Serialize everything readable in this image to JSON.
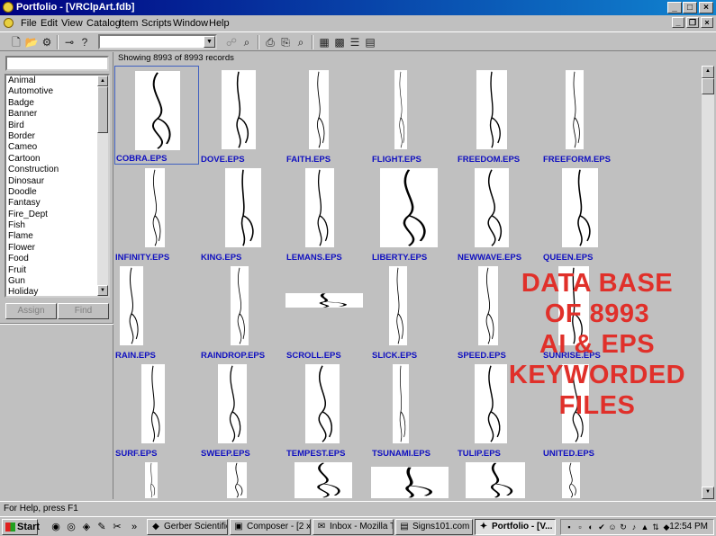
{
  "window": {
    "title": "Portfolio - [VRClpArt.fdb]",
    "minimize": "_",
    "maximize": "□",
    "close": "×"
  },
  "menu": [
    "File",
    "Edit",
    "View",
    "Catalog",
    "Item",
    "Scripts",
    "Window",
    "Help"
  ],
  "toolbar": {
    "search_combo_value": ""
  },
  "left_pane": {
    "search_value": "",
    "keywords": [
      "Animal",
      "Automotive",
      "Badge",
      "Banner",
      "Bird",
      "Border",
      "Cameo",
      "Cartoon",
      "Construction",
      "Dinosaur",
      "Doodle",
      "Fantasy",
      "Fire_Dept",
      "Fish",
      "Flame",
      "Flower",
      "Food",
      "Fruit",
      "Gun",
      "Holiday"
    ],
    "assign_label": "Assign",
    "find_label": "Find"
  },
  "records_status": "Showing 8993 of 8993 records",
  "thumbnails": [
    "COBRA.EPS",
    "DOVE.EPS",
    "FAITH.EPS",
    "FLIGHT.EPS",
    "FREEDOM.EPS",
    "FREEFORM.EPS",
    "INFINITY.EPS",
    "KING.EPS",
    "LEMANS.EPS",
    "LIBERTY.EPS",
    "NEWWAVE.EPS",
    "QUEEN.EPS",
    "RAIN.EPS",
    "RAINDROP.EPS",
    "SCROLL.EPS",
    "SLICK.EPS",
    "SPEED.EPS",
    "SUNRISE.EPS",
    "SURF.EPS",
    "SWEEP.EPS",
    "TEMPEST.EPS",
    "TSUNAMI.EPS",
    "TULIP.EPS",
    "UNITED.EPS",
    "",
    "",
    "",
    "",
    "",
    ""
  ],
  "overlay_lines": [
    "DATA BASE",
    "OF 8993",
    "AI & EPS",
    "KEYWORDED",
    "FILES"
  ],
  "status_bar": "For Help, press F1",
  "taskbar": {
    "start_label": "Start",
    "tasks": [
      "Gerber Scientific ...",
      "Composer - [2 x ...",
      "Inbox - Mozilla T...",
      "Signs101.com - ...",
      "Portfolio - [V..."
    ],
    "clock": "12:54 PM"
  },
  "colors": {
    "title_start": "#000080",
    "title_end": "#1084d0",
    "overlay": "#e0302a",
    "label": "#1010c0"
  }
}
